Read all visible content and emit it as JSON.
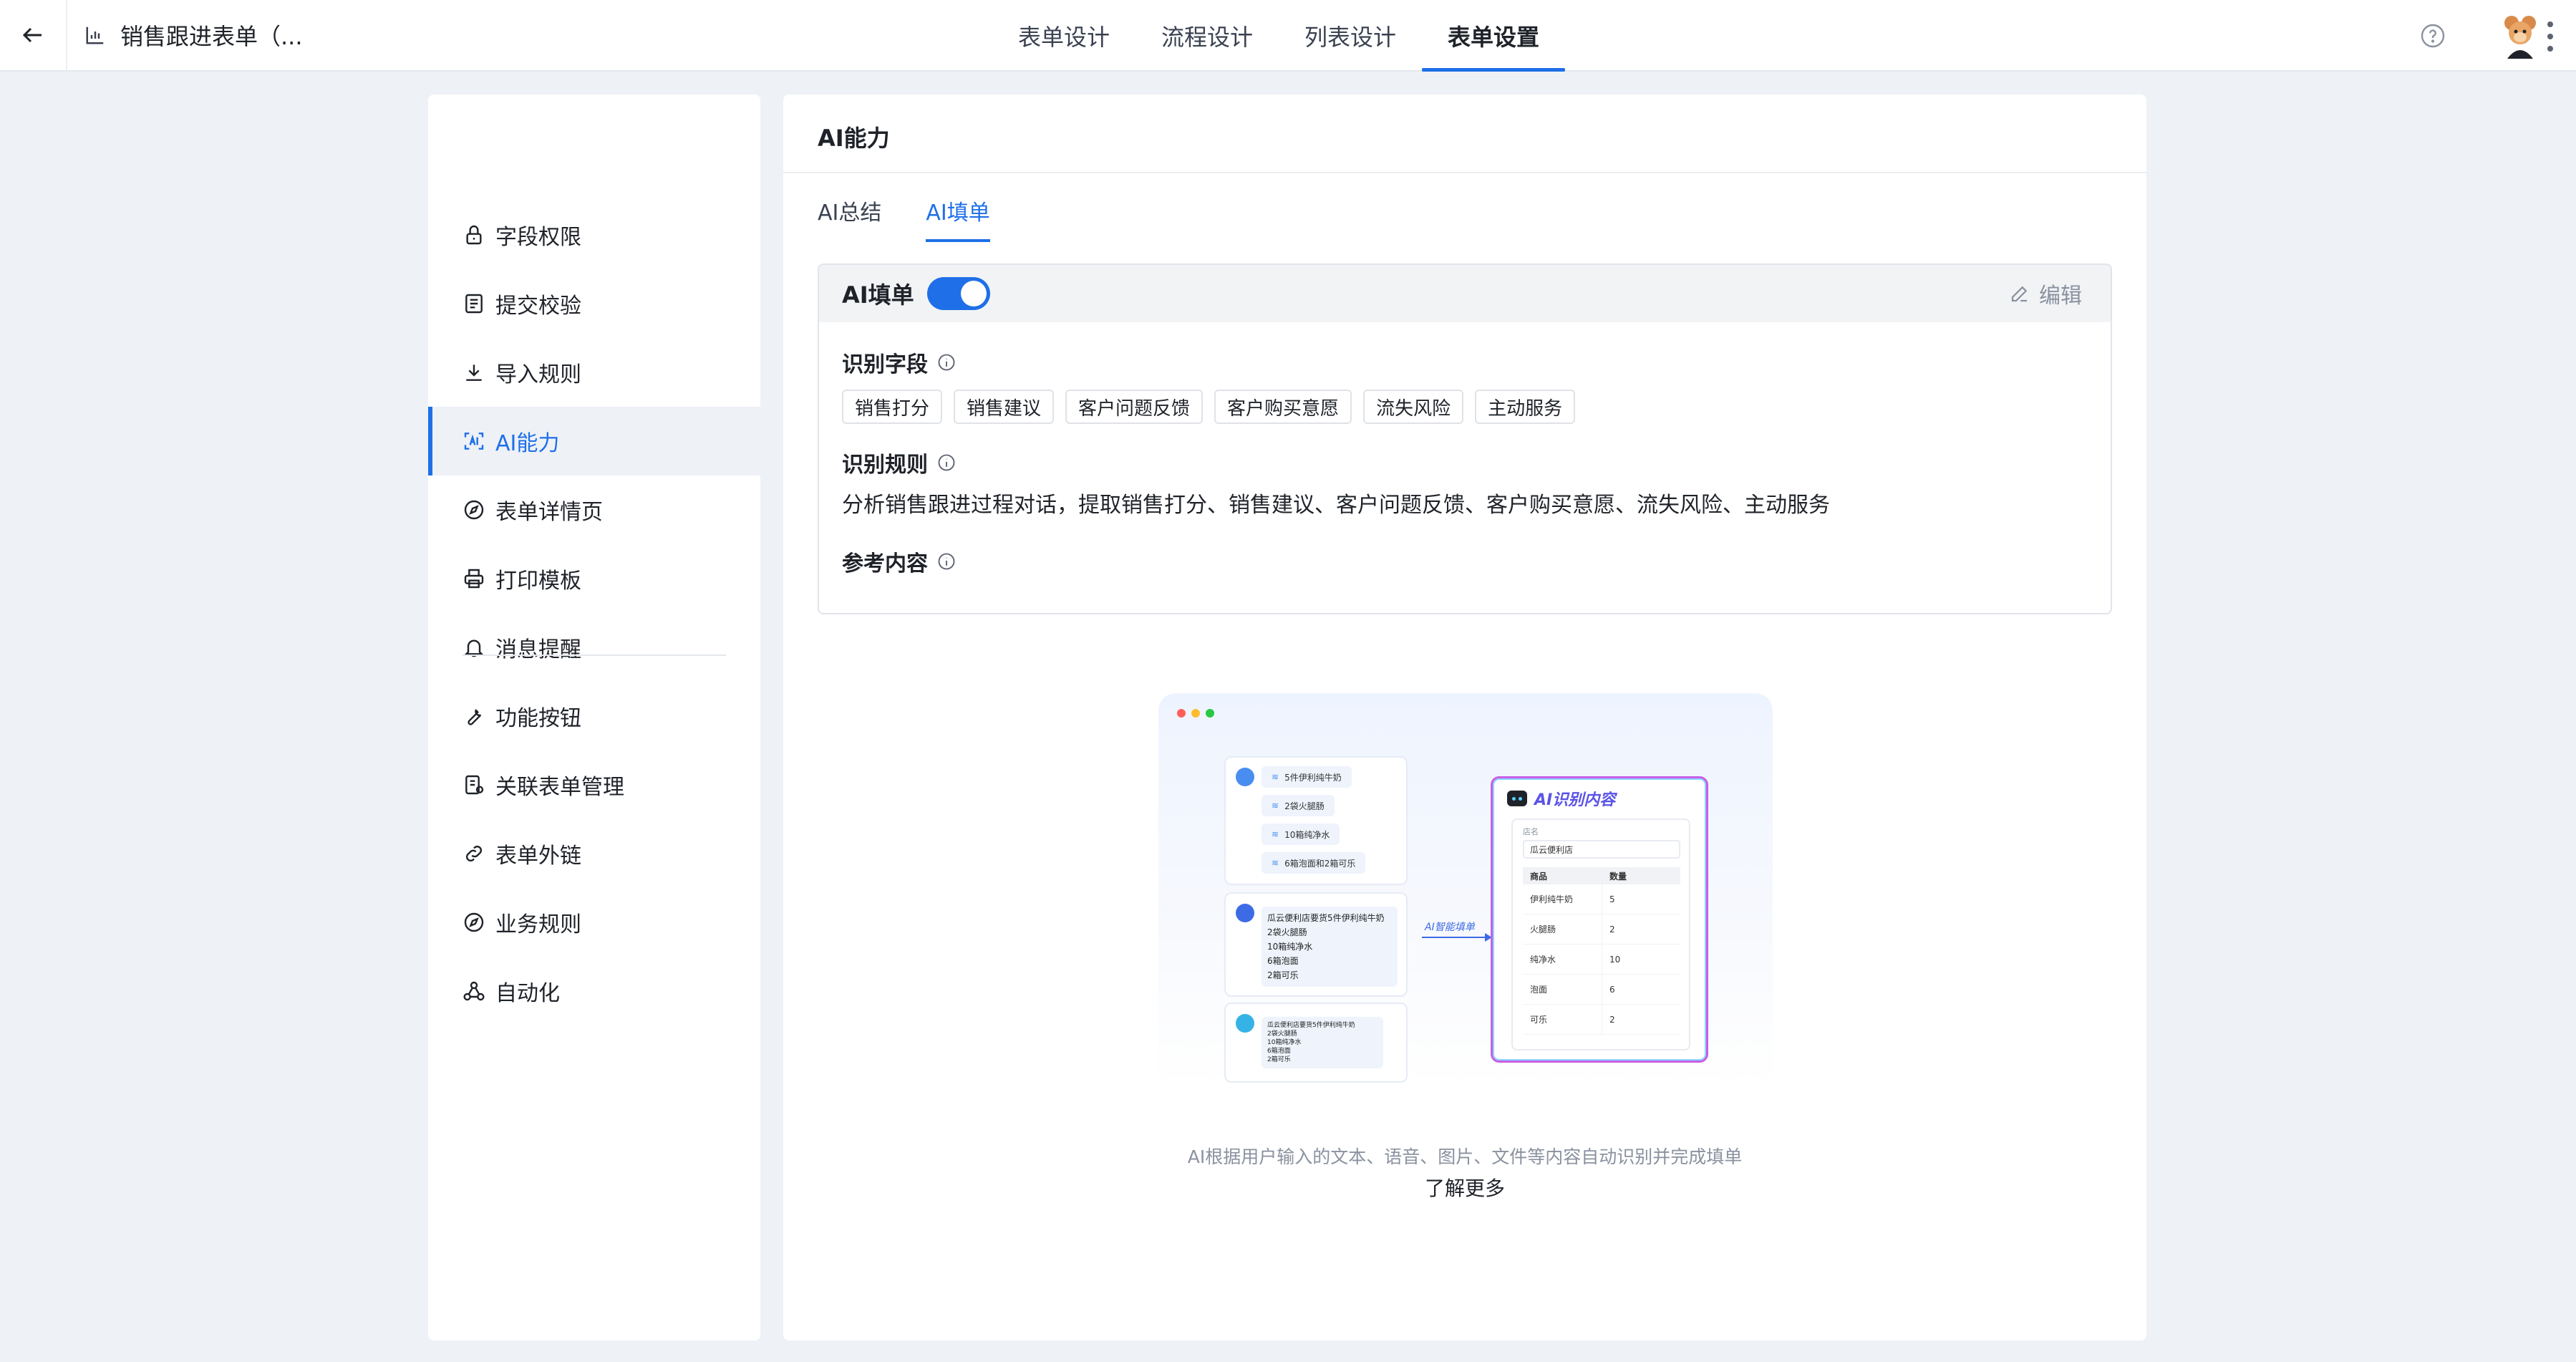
{
  "header": {
    "title": "销售跟进表单（...",
    "nav_tabs": [
      {
        "label": "表单设计",
        "active": false
      },
      {
        "label": "流程设计",
        "active": false
      },
      {
        "label": "列表设计",
        "active": false
      },
      {
        "label": "表单设置",
        "active": true
      }
    ],
    "icons": {
      "back": "arrow-left-icon",
      "app": "bar-chart-icon",
      "help": "help-icon",
      "more": "more-vertical-icon"
    }
  },
  "sidebar": {
    "items": [
      {
        "label": "字段权限",
        "icon": "lock-icon",
        "active": false
      },
      {
        "label": "提交校验",
        "icon": "checklist-icon",
        "active": false
      },
      {
        "label": "导入规则",
        "icon": "download-icon",
        "active": false
      },
      {
        "label": "AI能力",
        "icon": "ai-scan-icon",
        "active": true
      },
      {
        "label": "表单详情页",
        "icon": "compass-icon",
        "active": false
      },
      {
        "label": "打印模板",
        "icon": "printer-icon",
        "active": false
      },
      {
        "label": "消息提醒",
        "icon": "bell-icon",
        "active": false
      },
      {
        "label": "功能按钮",
        "icon": "tool-icon",
        "active": false
      },
      {
        "label": "关联表单管理",
        "icon": "link-form-icon",
        "active": false
      },
      {
        "label": "表单外链",
        "icon": "link-icon",
        "active": false
      },
      {
        "label": "业务规则",
        "icon": "compass-icon",
        "active": false
      },
      {
        "label": "自动化",
        "icon": "automation-icon",
        "active": false
      }
    ]
  },
  "main": {
    "title": "AI能力",
    "tabs": [
      {
        "label": "AI总结",
        "active": false
      },
      {
        "label": "AI填单",
        "active": true
      }
    ],
    "card": {
      "title": "AI填单",
      "toggle_on": true,
      "edit_label": "编辑",
      "fields_label": "识别字段",
      "fields": [
        "销售打分",
        "销售建议",
        "客户问题反馈",
        "客户购买意愿",
        "流失风险",
        "主动服务"
      ],
      "rules_label": "识别规则",
      "rules_text": "分析销售跟进过程对话，提取销售打分、销售建议、客户问题反馈、客户购买意愿、流失风险、主动服务",
      "reference_label": "参考内容"
    },
    "illustration": {
      "voice_messages": [
        "5件伊利纯牛奶",
        "2袋火腿肠",
        "10箱纯净水",
        "6箱泡面和2箱可乐"
      ],
      "text_message": [
        "瓜云便利店要货5件伊利纯牛奶",
        "2袋火腿肠",
        "10箱纯净水",
        "6箱泡面",
        "2箱可乐"
      ],
      "image_message": [
        "瓜云便利店要货5件伊利纯牛奶",
        "2袋火腿肠",
        "10箱纯净水",
        "6箱泡面",
        "2箱可乐"
      ],
      "arrow_label": "AI智能填单",
      "ai_title": "AI识别内容",
      "store_label": "店名",
      "store_value": "瓜云便利店",
      "table_headers": [
        "商品",
        "数量"
      ],
      "table_rows": [
        [
          "伊利纯牛奶",
          "5"
        ],
        [
          "火腿肠",
          "2"
        ],
        [
          "纯净水",
          "10"
        ],
        [
          "泡面",
          "6"
        ],
        [
          "可乐",
          "2"
        ]
      ]
    },
    "caption": "AI根据用户输入的文本、语音、图片、文件等内容自动识别并完成填单",
    "learn_more": "了解更多"
  },
  "colors": {
    "accent": "#1e6fe8",
    "background": "#eef1f6",
    "ai_purple": "#c75ee6"
  }
}
